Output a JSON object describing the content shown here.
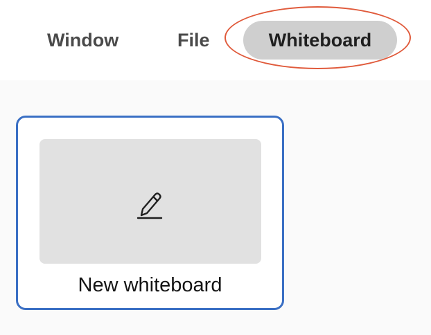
{
  "menu": {
    "tabs": [
      {
        "label": "Window"
      },
      {
        "label": "File"
      },
      {
        "label": "Whiteboard",
        "selected": true
      }
    ]
  },
  "card": {
    "label": "New whiteboard",
    "icon": "pencil-edit-icon"
  },
  "colors": {
    "selected_tab_bg": "#cfcfcf",
    "card_border": "#3a6fc4",
    "highlight_ring": "#e05a3b",
    "thumb_bg": "#e1e1e1"
  }
}
